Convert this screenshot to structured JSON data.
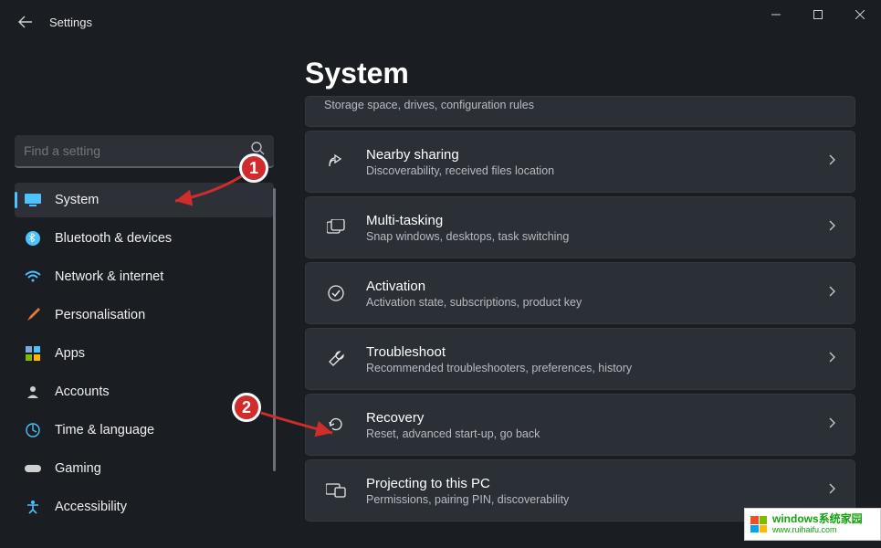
{
  "window": {
    "title": "Settings"
  },
  "search": {
    "placeholder": "Find a setting"
  },
  "sidebar": {
    "items": [
      {
        "label": "System",
        "icon": "display-icon",
        "color": "#4cc2ff",
        "selected": true
      },
      {
        "label": "Bluetooth & devices",
        "icon": "bluetooth-icon",
        "color": "#4cc2ff"
      },
      {
        "label": "Network & internet",
        "icon": "wifi-icon",
        "color": "#4cc2ff"
      },
      {
        "label": "Personalisation",
        "icon": "brush-icon",
        "color": "#e07b3c"
      },
      {
        "label": "Apps",
        "icon": "apps-icon",
        "color": "#7aa9e0"
      },
      {
        "label": "Accounts",
        "icon": "person-icon",
        "color": "#d0d0d0"
      },
      {
        "label": "Time & language",
        "icon": "globe-clock-icon",
        "color": "#4cc2ff"
      },
      {
        "label": "Gaming",
        "icon": "gamepad-icon",
        "color": "#d0d0d0"
      },
      {
        "label": "Accessibility",
        "icon": "accessibility-icon",
        "color": "#4cc2ff"
      }
    ]
  },
  "main": {
    "title": "System",
    "cards": [
      {
        "title": "",
        "sub": "Storage space, drives, configuration rules",
        "icon": "storage-icon",
        "partial": true
      },
      {
        "title": "Nearby sharing",
        "sub": "Discoverability, received files location",
        "icon": "share-icon"
      },
      {
        "title": "Multi-tasking",
        "sub": "Snap windows, desktops, task switching",
        "icon": "multitask-icon"
      },
      {
        "title": "Activation",
        "sub": "Activation state, subscriptions, product key",
        "icon": "activation-check-icon"
      },
      {
        "title": "Troubleshoot",
        "sub": "Recommended troubleshooters, preferences, history",
        "icon": "wrench-icon"
      },
      {
        "title": "Recovery",
        "sub": "Reset, advanced start-up, go back",
        "icon": "recovery-icon"
      },
      {
        "title": "Projecting to this PC",
        "sub": "Permissions, pairing PIN, discoverability",
        "icon": "project-icon"
      }
    ]
  },
  "annotations": {
    "badge1": "1",
    "badge2": "2"
  },
  "watermark": {
    "line1": "windows系统家园",
    "line2": "www.ruihaifu.com"
  },
  "colors": {
    "accent": "#4cc2ff",
    "annotation": "#d12c2c",
    "card_bg": "#2b2f36",
    "bg": "#1a1d22"
  }
}
